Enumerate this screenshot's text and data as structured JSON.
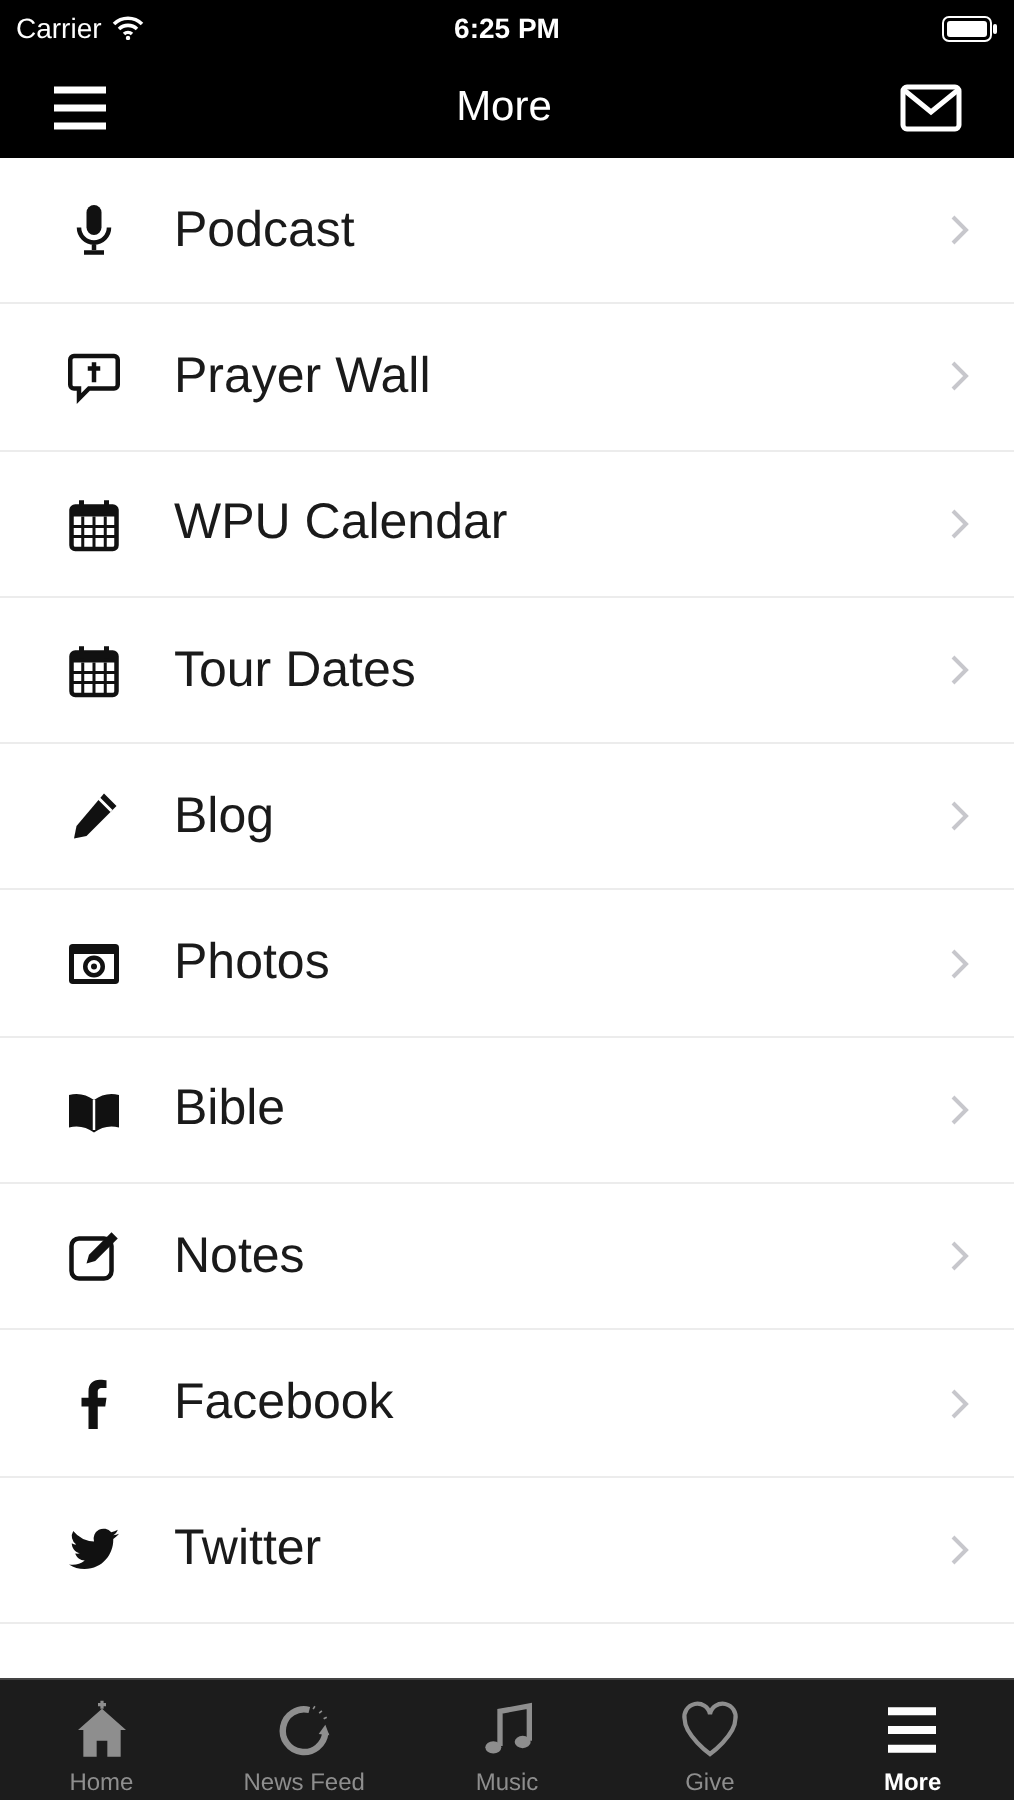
{
  "status_bar": {
    "carrier": "Carrier",
    "time": "6:25 PM"
  },
  "nav_bar": {
    "title": "More"
  },
  "items": [
    {
      "label": "Podcast"
    },
    {
      "label": "Prayer Wall"
    },
    {
      "label": "WPU Calendar"
    },
    {
      "label": "Tour Dates"
    },
    {
      "label": "Blog"
    },
    {
      "label": "Photos"
    },
    {
      "label": "Bible"
    },
    {
      "label": "Notes"
    },
    {
      "label": "Facebook"
    },
    {
      "label": "Twitter"
    }
  ],
  "tab_bar": [
    {
      "label": "Home",
      "selected": false
    },
    {
      "label": "News Feed",
      "selected": false
    },
    {
      "label": "Music",
      "selected": false
    },
    {
      "label": "Give",
      "selected": false
    },
    {
      "label": "More",
      "selected": true
    }
  ]
}
